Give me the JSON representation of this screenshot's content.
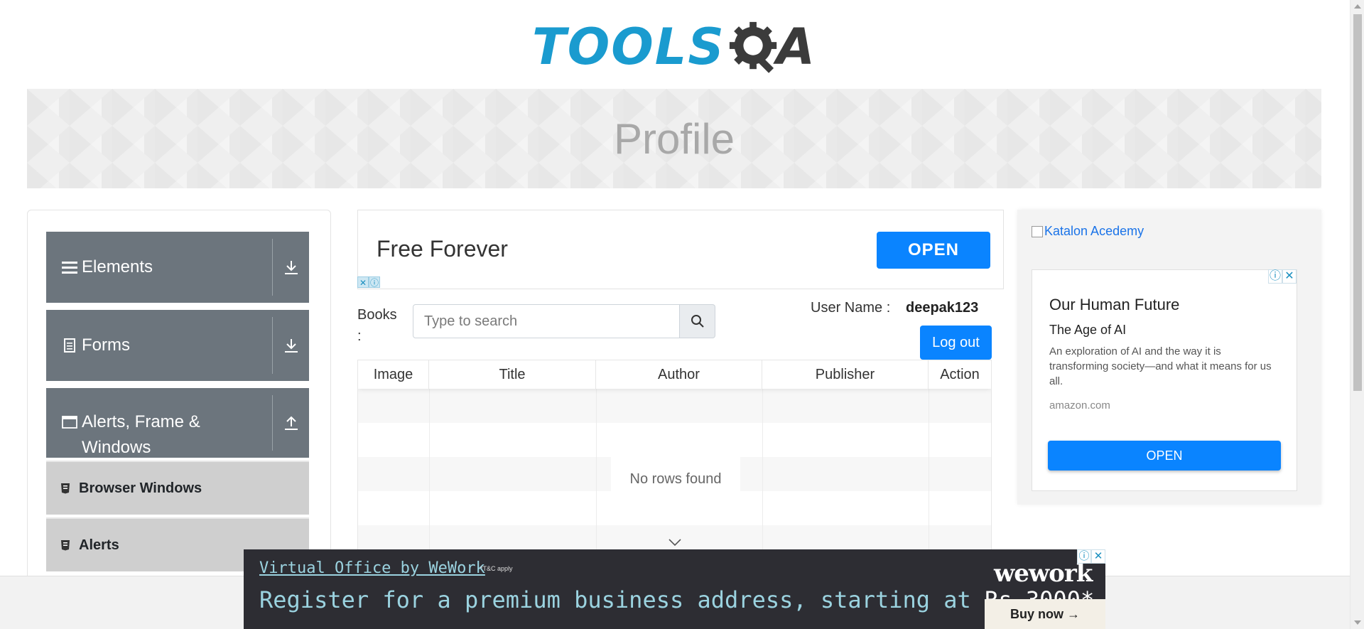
{
  "logo": {
    "part1": "TOOLS",
    "part2": "A"
  },
  "banner": {
    "title": "Profile"
  },
  "sidebar": {
    "groups": [
      {
        "label": "Elements",
        "icon": "hamburger-icon",
        "toggle": "download-icon"
      },
      {
        "label": "Forms",
        "icon": "document-icon",
        "toggle": "download-icon"
      },
      {
        "label": "Alerts, Frame & Windows",
        "icon": "window-icon",
        "toggle": "upload-icon"
      }
    ],
    "items": [
      {
        "label": "Browser Windows"
      },
      {
        "label": "Alerts"
      }
    ]
  },
  "top_ad": {
    "text": "Free Forever",
    "button": "OPEN"
  },
  "books": {
    "label": "Books :",
    "search_placeholder": "Type to search",
    "user_label": "User Name :",
    "user_value": "deepak123",
    "logout": "Log out",
    "columns": [
      "Image",
      "Title",
      "Author",
      "Publisher",
      "Action"
    ],
    "empty_text": "No rows found"
  },
  "right_ad": {
    "image_alt": "Katalon Acedemy",
    "headline": "Our Human Future",
    "subheadline": "The Age of AI",
    "description": "An exploration of AI and the way it is transforming society—and what it means for us all.",
    "domain": "amazon.com",
    "button": "OPEN"
  },
  "bottom_ad": {
    "line1": "Virtual Office by WeWork",
    "tc": "*T&C apply",
    "line2_prefix": "Register for a premium business address, starting at ",
    "line2_price": "Rs.3000*",
    "brand": "wework",
    "button": "Buy now →"
  },
  "colors": {
    "primary": "#0a84ff",
    "nav": "#6c757d",
    "logo_blue": "#1a9bcf"
  }
}
